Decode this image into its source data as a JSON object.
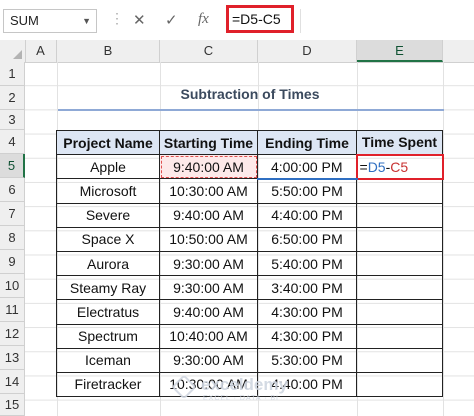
{
  "formula_bar": {
    "name_box": "SUM",
    "cancel_icon": "✕",
    "enter_icon": "✓",
    "fx_icon": "fx",
    "formula": "=D5-C5"
  },
  "columns": [
    "A",
    "B",
    "C",
    "D",
    "E"
  ],
  "selected_column": "E",
  "rows": [
    "1",
    "2",
    "3",
    "4",
    "5",
    "6",
    "7",
    "8",
    "9",
    "10",
    "11",
    "12",
    "13",
    "14",
    "15"
  ],
  "selected_row": "5",
  "title": "Subtraction of Times",
  "table": {
    "headers": [
      "Project Name",
      "Starting Time",
      "Ending Time",
      "Time Spent"
    ],
    "rows": [
      [
        "Apple",
        "9:40:00 AM",
        "4:00:00 PM"
      ],
      [
        "Microsoft",
        "10:30:00 AM",
        "5:50:00 PM"
      ],
      [
        "Severe",
        "9:40:00 AM",
        "4:40:00 PM"
      ],
      [
        "Space X",
        "10:50:00 AM",
        "6:50:00 PM"
      ],
      [
        "Aurora",
        "9:30:00 AM",
        "5:40:00 PM"
      ],
      [
        "Steamy Ray",
        "9:30:00 AM",
        "3:40:00 PM"
      ],
      [
        "Electratus",
        "9:40:00 AM",
        "4:30:00 PM"
      ],
      [
        "Spectrum",
        "10:40:00 AM",
        "4:30:00 PM"
      ],
      [
        "Iceman",
        "9:30:00 AM",
        "5:30:00 PM"
      ],
      [
        "Firetracker",
        "10:30:00 AM",
        "4:40:00 PM"
      ]
    ],
    "active_formula": {
      "eq": "=",
      "d": "D5",
      "op": "-",
      "c": "C5"
    }
  },
  "watermark": {
    "name": "exceldemy",
    "tagline": "EXCEL · DATA · BI"
  },
  "colors": {
    "selection_red": "#e0202a",
    "header_fill": "#dde6f4",
    "ref_blue": "#2f6fc2",
    "ref_red": "#c83232"
  }
}
